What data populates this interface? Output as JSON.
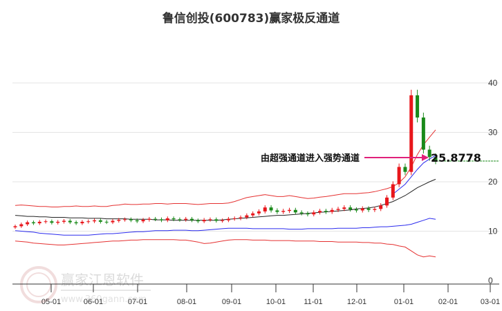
{
  "chart_data": {
    "type": "candlestick",
    "title": "鲁信创投(600783)赢家极反通道",
    "y_ticks": [
      0,
      10,
      20,
      30,
      40
    ],
    "ylim": [
      0,
      40
    ],
    "x_ticks": [
      "05-01",
      "06-01",
      "07-01",
      "08-01",
      "09-01",
      "10-01",
      "11-01",
      "12-01",
      "01-01",
      "02-01",
      "03-01"
    ],
    "annotation": {
      "text": "由超强通道进入强势通道",
      "value": "25.8778",
      "value_num": 25.8778
    },
    "support_level": 24.2,
    "closes": [
      11.0,
      11.4,
      11.8,
      11.6,
      11.9,
      12.0,
      11.7,
      11.9,
      12.1,
      11.8,
      11.6,
      11.9,
      12.0,
      12.2,
      11.9,
      11.8,
      12.1,
      12.3,
      12.4,
      12.2,
      12.0,
      12.3,
      12.5,
      12.4,
      12.2,
      12.6,
      12.4,
      12.3,
      12.5,
      12.2,
      12.0,
      12.3,
      12.4,
      12.1,
      12.2,
      12.5,
      12.6,
      12.8,
      13.2,
      13.6,
      14.0,
      14.8,
      14.2,
      13.9,
      14.1,
      14.3,
      13.8,
      13.6,
      13.4,
      13.8,
      14.1,
      13.9,
      14.3,
      14.5,
      14.8,
      14.4,
      14.2,
      14.6,
      14.3,
      14.5,
      15.2,
      16.8,
      19.5,
      23.0,
      22.0,
      37.5,
      33.0,
      26.5,
      25.0,
      24.3
    ],
    "upper_red": [
      15.2,
      15.3,
      15.2,
      15.1,
      15.0,
      15.0,
      14.9,
      14.9,
      15.0,
      15.0,
      15.1,
      15.0,
      15.0,
      15.1,
      15.0,
      15.0,
      15.2,
      15.3,
      15.5,
      15.4,
      15.4,
      15.5,
      15.5,
      15.6,
      15.6,
      15.5,
      15.6,
      15.6,
      15.6,
      15.5,
      15.4,
      15.5,
      15.6,
      15.6,
      15.6,
      15.7,
      16.0,
      16.4,
      16.8,
      17.0,
      17.2,
      17.4,
      17.2,
      17.0,
      17.0,
      17.2,
      17.0,
      16.8,
      16.6,
      16.7,
      16.9,
      17.0,
      17.2,
      17.4,
      17.6,
      17.6,
      17.6,
      17.7,
      17.8,
      18.0,
      18.3,
      18.6,
      19.0,
      19.8,
      21.0,
      23.0,
      25.5,
      27.5,
      29.0,
      30.5
    ],
    "upper_blue": [
      null,
      null,
      null,
      null,
      null,
      null,
      null,
      null,
      null,
      null,
      null,
      null,
      null,
      null,
      null,
      null,
      null,
      null,
      null,
      null,
      null,
      null,
      null,
      null,
      null,
      null,
      null,
      null,
      null,
      null,
      null,
      null,
      null,
      null,
      null,
      null,
      null,
      null,
      null,
      null,
      null,
      null,
      null,
      null,
      null,
      null,
      null,
      null,
      null,
      null,
      null,
      null,
      null,
      null,
      null,
      null,
      null,
      null,
      null,
      null,
      null,
      null,
      17.5,
      18.5,
      19.5,
      21.0,
      22.5,
      23.8,
      24.6,
      25.3
    ],
    "mid_black": [
      13.2,
      13.1,
      13.0,
      13.0,
      12.9,
      12.9,
      12.8,
      12.8,
      12.8,
      12.7,
      12.7,
      12.7,
      12.6,
      12.6,
      12.6,
      12.5,
      12.5,
      12.5,
      12.5,
      12.4,
      12.4,
      12.4,
      12.4,
      12.3,
      12.3,
      12.3,
      12.2,
      12.2,
      12.2,
      12.2,
      12.2,
      12.2,
      12.2,
      12.2,
      12.3,
      12.4,
      12.5,
      12.6,
      12.7,
      12.8,
      12.9,
      13.0,
      13.1,
      13.2,
      13.2,
      13.3,
      13.4,
      13.5,
      13.6,
      13.7,
      13.8,
      13.9,
      14.0,
      14.1,
      14.2,
      14.3,
      14.5,
      14.6,
      14.7,
      14.9,
      15.2,
      15.6,
      16.0,
      16.6,
      17.2,
      18.0,
      18.8,
      19.4,
      20.0,
      20.5
    ],
    "lower_blue": [
      10.1,
      10.0,
      9.9,
      9.8,
      9.6,
      9.5,
      9.4,
      9.3,
      9.2,
      9.2,
      9.2,
      9.2,
      9.2,
      9.3,
      9.4,
      9.5,
      9.5,
      9.6,
      9.7,
      9.8,
      9.9,
      9.9,
      10.0,
      10.1,
      10.1,
      10.1,
      10.2,
      10.2,
      10.2,
      10.1,
      10.1,
      10.2,
      10.3,
      10.4,
      10.5,
      10.6,
      10.6,
      10.6,
      10.6,
      10.5,
      10.5,
      10.5,
      10.5,
      10.5,
      10.5,
      10.4,
      10.4,
      10.4,
      10.5,
      10.5,
      10.5,
      10.5,
      10.5,
      10.6,
      10.6,
      10.6,
      10.6,
      10.7,
      10.7,
      10.8,
      10.9,
      10.9,
      11.0,
      11.1,
      11.2,
      11.4,
      11.8,
      12.2,
      12.6,
      12.4
    ],
    "lower_red": [
      8.0,
      7.9,
      7.8,
      7.6,
      7.5,
      7.4,
      7.3,
      7.2,
      7.2,
      7.3,
      7.4,
      7.5,
      7.6,
      7.7,
      7.8,
      7.9,
      8.0,
      8.0,
      8.1,
      8.2,
      8.2,
      8.3,
      8.3,
      8.3,
      8.3,
      8.3,
      8.3,
      8.2,
      8.2,
      8.0,
      7.8,
      7.5,
      7.6,
      7.8,
      8.0,
      8.2,
      8.3,
      8.3,
      8.3,
      8.2,
      8.2,
      8.2,
      8.1,
      8.1,
      8.1,
      8.1,
      8.0,
      8.0,
      8.0,
      8.0,
      7.9,
      7.9,
      7.9,
      7.8,
      7.8,
      7.8,
      7.8,
      7.7,
      7.7,
      7.6,
      7.6,
      7.4,
      7.3,
      7.0,
      6.8,
      6.0,
      5.2,
      4.8,
      5.0,
      4.8
    ]
  },
  "watermark": {
    "brand": "赢家江恩软件",
    "url": "www.360gann.com",
    "seal": "江赢恩家"
  }
}
